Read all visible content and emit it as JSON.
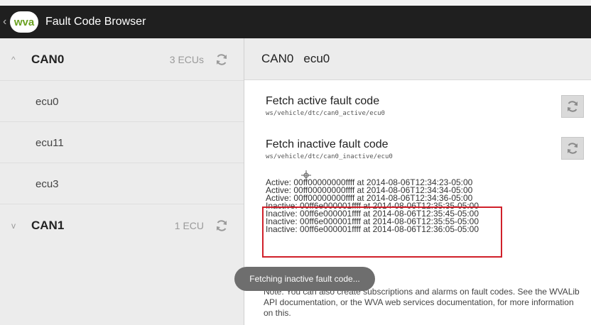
{
  "app": {
    "logo_text": "wva",
    "title": "Fault Code Browser",
    "up_glyph": "‹"
  },
  "icons": {
    "up": "chevron-left-icon",
    "refresh": "refresh-icon",
    "expand": "chevron-up-icon",
    "collapse": "chevron-down-icon"
  },
  "colors": {
    "action_bar": "#1f1f1f",
    "logo_green": "#6aa121",
    "left_panel": "#ececec",
    "highlight": "#d0202a",
    "toast": "#6e6e6e"
  },
  "groups": [
    {
      "name": "CAN0",
      "count": "3 ECUs",
      "chevron": "^",
      "ecus": [
        "ecu0",
        "ecu11",
        "ecu3"
      ]
    },
    {
      "name": "CAN1",
      "count": "1 ECU",
      "chevron": "v"
    }
  ],
  "detail": {
    "can": "CAN0",
    "ecu": "ecu0",
    "active": {
      "title": "Fetch active fault code",
      "path": "ws/vehicle/dtc/can0_active/ecu0"
    },
    "inactive": {
      "title": "Fetch inactive fault code",
      "path": "ws/vehicle/dtc/can0_inactive/ecu0"
    },
    "log": [
      "Active: 00ff00000000ffff at 2014-08-06T12:34:23-05:00",
      "Active: 00ff00000000ffff at 2014-08-06T12:34:34-05:00",
      "Active: 00ff00000000ffff at 2014-08-06T12:34:36-05:00",
      "Inactive: 00ff6e000001ffff at 2014-08-06T12:35:35-05:00",
      "Inactive: 00ff6e000001ffff at 2014-08-06T12:35:45-05:00",
      "Inactive: 00ff6e000001ffff at 2014-08-06T12:35:55-05:00",
      "Inactive: 00ff6e000001ffff at 2014-08-06T12:36:05-05:00"
    ],
    "note": "Note: You can also create subscriptions and alarms on fault codes. See the WVALib API documentation, or the WVA web services documentation, for more information on this."
  },
  "toast": "Fetching inactive fault code..."
}
